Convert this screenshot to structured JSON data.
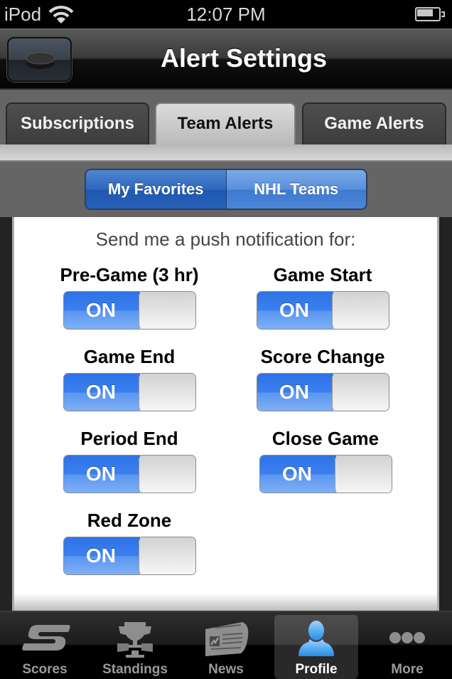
{
  "status_bar": {
    "carrier": "iPod",
    "wifi_icon": "wifi-icon",
    "time": "12:07 PM",
    "battery_icon": "battery-icon"
  },
  "nav_bar": {
    "title": "Alert Settings",
    "left_button_icon": "hockey-puck-icon"
  },
  "tabs": [
    {
      "label": "Subscriptions",
      "selected": false
    },
    {
      "label": "Team Alerts",
      "selected": true
    },
    {
      "label": "Game Alerts",
      "selected": false
    }
  ],
  "segmented": [
    {
      "label": "My Favorites",
      "selected": true
    },
    {
      "label": "NHL Teams",
      "selected": false
    }
  ],
  "content": {
    "intro": "Send me a push notification for:",
    "alerts": [
      {
        "label": "Pre-Game (3 hr)",
        "state": "ON"
      },
      {
        "label": "Game Start",
        "state": "ON"
      },
      {
        "label": "Game End",
        "state": "ON"
      },
      {
        "label": "Score Change",
        "state": "ON"
      },
      {
        "label": "Period End",
        "state": "ON"
      },
      {
        "label": "Close Game",
        "state": "ON"
      },
      {
        "label": "Red Zone",
        "state": "ON"
      }
    ]
  },
  "tab_bar": [
    {
      "label": "Scores",
      "icon": "scores-icon",
      "selected": false
    },
    {
      "label": "Standings",
      "icon": "trophy-icon",
      "selected": false
    },
    {
      "label": "News",
      "icon": "newspaper-icon",
      "selected": false
    },
    {
      "label": "Profile",
      "icon": "person-icon",
      "selected": true
    },
    {
      "label": "More",
      "icon": "more-icon",
      "selected": false
    }
  ],
  "colors": {
    "toggle_on": "#3b7ff0",
    "segment_selected": "#2f67bd",
    "profile_icon": "#3aa4f0"
  }
}
